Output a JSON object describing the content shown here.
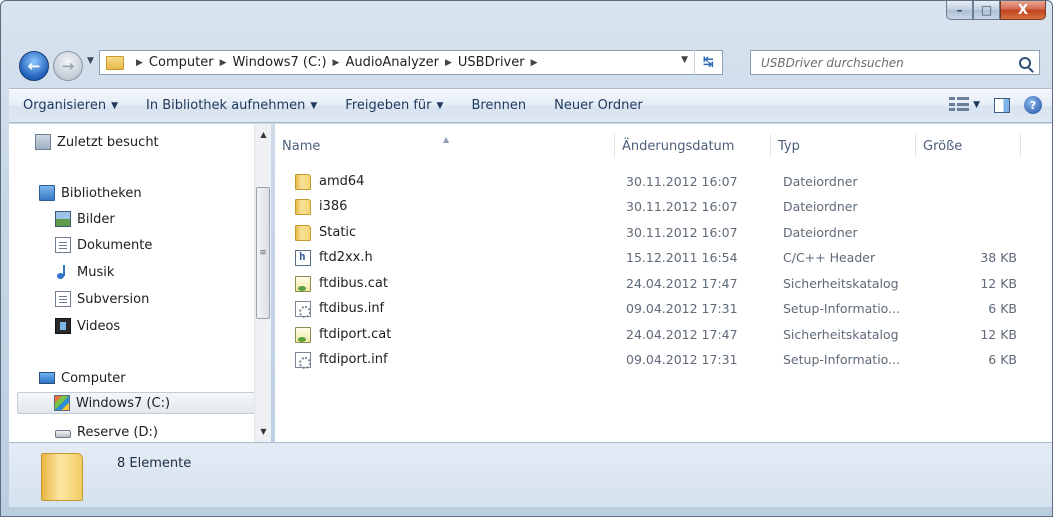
{
  "window": {
    "minimize": "–",
    "maximize": "□",
    "close": "X"
  },
  "address": {
    "crumbs": [
      "Computer",
      "Windows7 (C:)",
      "AudioAnalyzer",
      "USBDriver"
    ],
    "search_placeholder": "USBDriver durchsuchen"
  },
  "toolbar": {
    "organize": "Organisieren",
    "library": "In Bibliothek aufnehmen",
    "share": "Freigeben für",
    "burn": "Brennen",
    "new_folder": "Neuer Ordner"
  },
  "nav": {
    "recent": "Zuletzt besucht",
    "libraries": "Bibliotheken",
    "pictures": "Bilder",
    "documents": "Dokumente",
    "music": "Musik",
    "subversion": "Subversion",
    "videos": "Videos",
    "computer": "Computer",
    "drive_c": "Windows7 (C:)",
    "drive_d": "Reserve (D:)"
  },
  "columns": {
    "name": "Name",
    "date": "Änderungsdatum",
    "type": "Typ",
    "size": "Größe"
  },
  "files": [
    {
      "name": "amd64",
      "date": "30.11.2012 16:07",
      "type": "Dateiordner",
      "size": "",
      "icon": "folder"
    },
    {
      "name": "i386",
      "date": "30.11.2012 16:07",
      "type": "Dateiordner",
      "size": "",
      "icon": "folder"
    },
    {
      "name": "Static",
      "date": "30.11.2012 16:07",
      "type": "Dateiordner",
      "size": "",
      "icon": "folder"
    },
    {
      "name": "ftd2xx.h",
      "date": "15.12.2011 16:54",
      "type": "C/C++ Header",
      "size": "38 KB",
      "icon": "header"
    },
    {
      "name": "ftdibus.cat",
      "date": "24.04.2012 17:47",
      "type": "Sicherheitskatalog",
      "size": "12 KB",
      "icon": "catalog"
    },
    {
      "name": "ftdibus.inf",
      "date": "09.04.2012 17:31",
      "type": "Setup-Informatio...",
      "size": "6 KB",
      "icon": "setup-info"
    },
    {
      "name": "ftdiport.cat",
      "date": "24.04.2012 17:47",
      "type": "Sicherheitskatalog",
      "size": "12 KB",
      "icon": "catalog"
    },
    {
      "name": "ftdiport.inf",
      "date": "09.04.2012 17:31",
      "type": "Setup-Informatio...",
      "size": "6 KB",
      "icon": "setup-info"
    }
  ],
  "details": {
    "count": "8 Elemente"
  }
}
